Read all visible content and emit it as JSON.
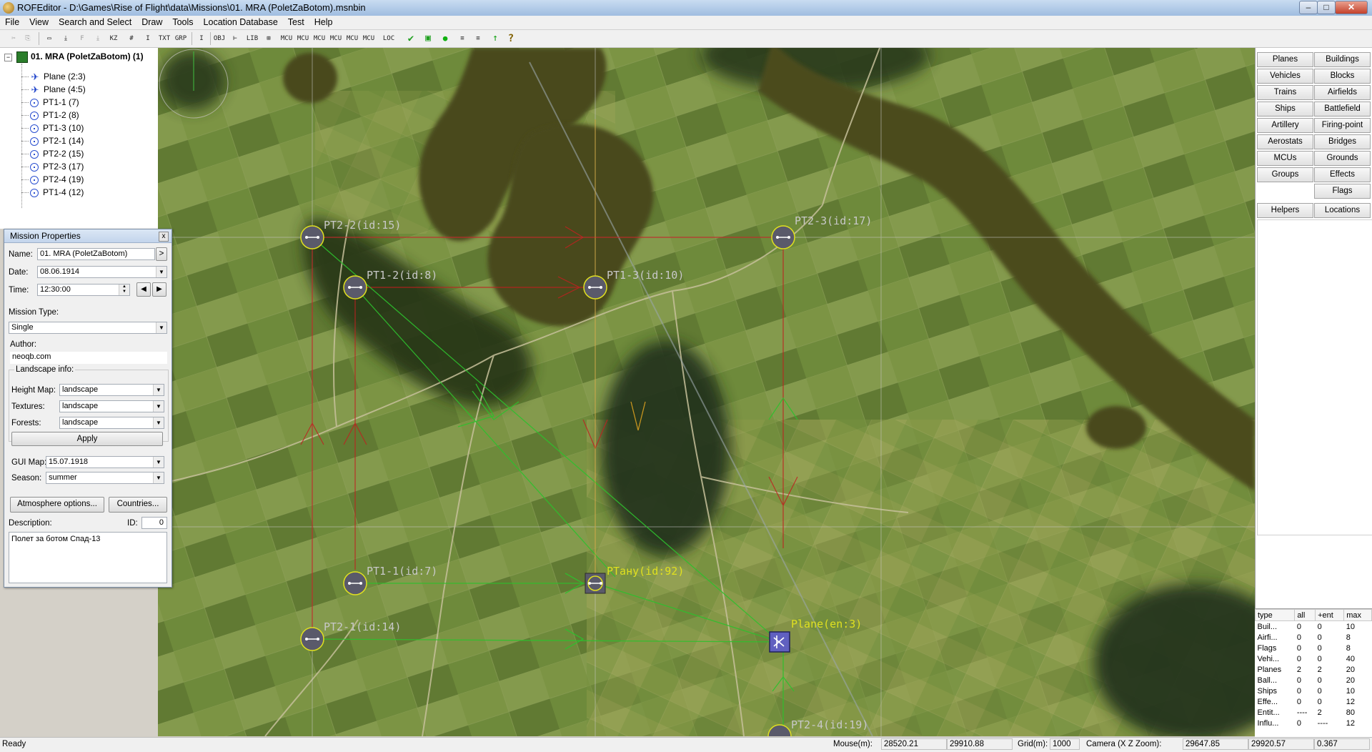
{
  "window": {
    "title": "ROFEditor - D:\\Games\\Rise of Flight\\data\\Missions\\01. MRA (PoletZaBotom).msnbin",
    "controls": {
      "minimize": "–",
      "maximize": "□",
      "close": "✕"
    }
  },
  "menu": [
    "File",
    "View",
    "Search and Select",
    "Draw",
    "Tools",
    "Location Database",
    "Test",
    "Help"
  ],
  "toolbar": {
    "buttons": [
      "✂",
      "⎘",
      "▭",
      "⤓",
      "F",
      "⤓",
      "KZ",
      "#",
      "I",
      "TXT",
      "GRP",
      "I",
      "OBJ FILT",
      "⊢",
      "LIB",
      "⊞",
      "MCU OBJ",
      "MCU TAR",
      "MCU MES",
      "MCU SEL",
      "MCU UNSE",
      "MCU ARW",
      "LOC",
      "✔",
      "▣",
      "●",
      "≡",
      "≡",
      "↑",
      "?"
    ]
  },
  "tree": {
    "root": "01. MRA (PoletZaBotom) (1)",
    "items": [
      {
        "label": "Plane (2:3)",
        "kind": "plane"
      },
      {
        "label": "Plane (4:5)",
        "kind": "plane"
      },
      {
        "label": "PT1-1 (7)",
        "kind": "point"
      },
      {
        "label": "PT1-2 (8)",
        "kind": "point"
      },
      {
        "label": "PT1-3 (10)",
        "kind": "point"
      },
      {
        "label": "PT2-1 (14)",
        "kind": "point"
      },
      {
        "label": "PT2-2 (15)",
        "kind": "point"
      },
      {
        "label": "PT2-3 (17)",
        "kind": "point"
      },
      {
        "label": "PT2-4 (19)",
        "kind": "point"
      },
      {
        "label": "PT1-4 (12)",
        "kind": "point"
      }
    ]
  },
  "mission_props": {
    "title": "Mission Properties",
    "close": "x",
    "name_label": "Name:",
    "name": "01. MRA (PoletZaBotom)",
    "name_btn": ">",
    "date_label": "Date:",
    "date": "08.06.1914",
    "time_label": "Time:",
    "time": "12:30:00",
    "mission_type_label": "Mission Type:",
    "mission_type": "Single",
    "author_label": "Author:",
    "author": "neoqb.com",
    "landscape_label": "Landscape info:",
    "height_map_label": "Height Map:",
    "height_map": "landscape",
    "textures_label": "Textures:",
    "textures": "landscape",
    "forests_label": "Forests:",
    "forests": "landscape",
    "apply": "Apply",
    "gui_map_label": "GUI Map:",
    "gui_map": "15.07.1918",
    "season_label": "Season:",
    "season": "summer",
    "atmosphere_btn": "Atmosphere options...",
    "countries_btn": "Countries...",
    "description_label": "Description:",
    "id_label": "ID:",
    "id": "0",
    "description": "Полет за ботом Спад-13"
  },
  "map": {
    "labels": {
      "pt22": "PT2-2(id:15)",
      "pt23": "PT2-3(id:17)",
      "pt12": "PT1-2(id:8)",
      "pt13": "PT1-3(id:10)",
      "pt11": "PT1-1(id:7)",
      "pt14": "PTану(id:92)",
      "pt21": "PT2-1(id:14)",
      "plane": "Plane(en:3)",
      "pt24": "PT2-4(id:19)"
    },
    "colors": {
      "grass": "#6f8a3c",
      "water": "#4a4a1e",
      "forest": "#2a3a1a",
      "red_route": "#c02020",
      "green_route": "#30c030"
    }
  },
  "right_panel": {
    "buttons": [
      "Planes",
      "Buildings",
      "Vehicles",
      "Blocks",
      "Trains",
      "Airfields",
      "Ships",
      "Battlefield",
      "Artillery",
      "Firing-point",
      "Aerostats",
      "Bridges",
      "MCUs",
      "Grounds",
      "Groups",
      "Effects",
      "",
      "Flags",
      "Helpers",
      "Locations"
    ]
  },
  "stats": {
    "headers": [
      "type",
      "all",
      "+ent",
      "max"
    ],
    "rows": [
      [
        "Buil...",
        "0",
        "0",
        "10"
      ],
      [
        "Airfi...",
        "0",
        "0",
        "8"
      ],
      [
        "Flags",
        "0",
        "0",
        "8"
      ],
      [
        "Vehi...",
        "0",
        "0",
        "40"
      ],
      [
        "Planes",
        "2",
        "2",
        "20"
      ],
      [
        "Ball...",
        "0",
        "0",
        "20"
      ],
      [
        "Ships",
        "0",
        "0",
        "10"
      ],
      [
        "Effe...",
        "0",
        "0",
        "12"
      ],
      [
        "Entit...",
        "----",
        "2",
        "80"
      ],
      [
        "Influ...",
        "0",
        "----",
        "12"
      ]
    ]
  },
  "status": {
    "ready": "Ready",
    "mouse_label": "Mouse(m):",
    "mouse_x": "28520.21",
    "mouse_z": "29910.88",
    "grid_label": "Grid(m):",
    "grid": "1000",
    "camera_label": "Camera (X Z Zoom):",
    "camera_x": "29647.85",
    "camera_z": "29920.57",
    "camera_zoom": "0.367"
  }
}
